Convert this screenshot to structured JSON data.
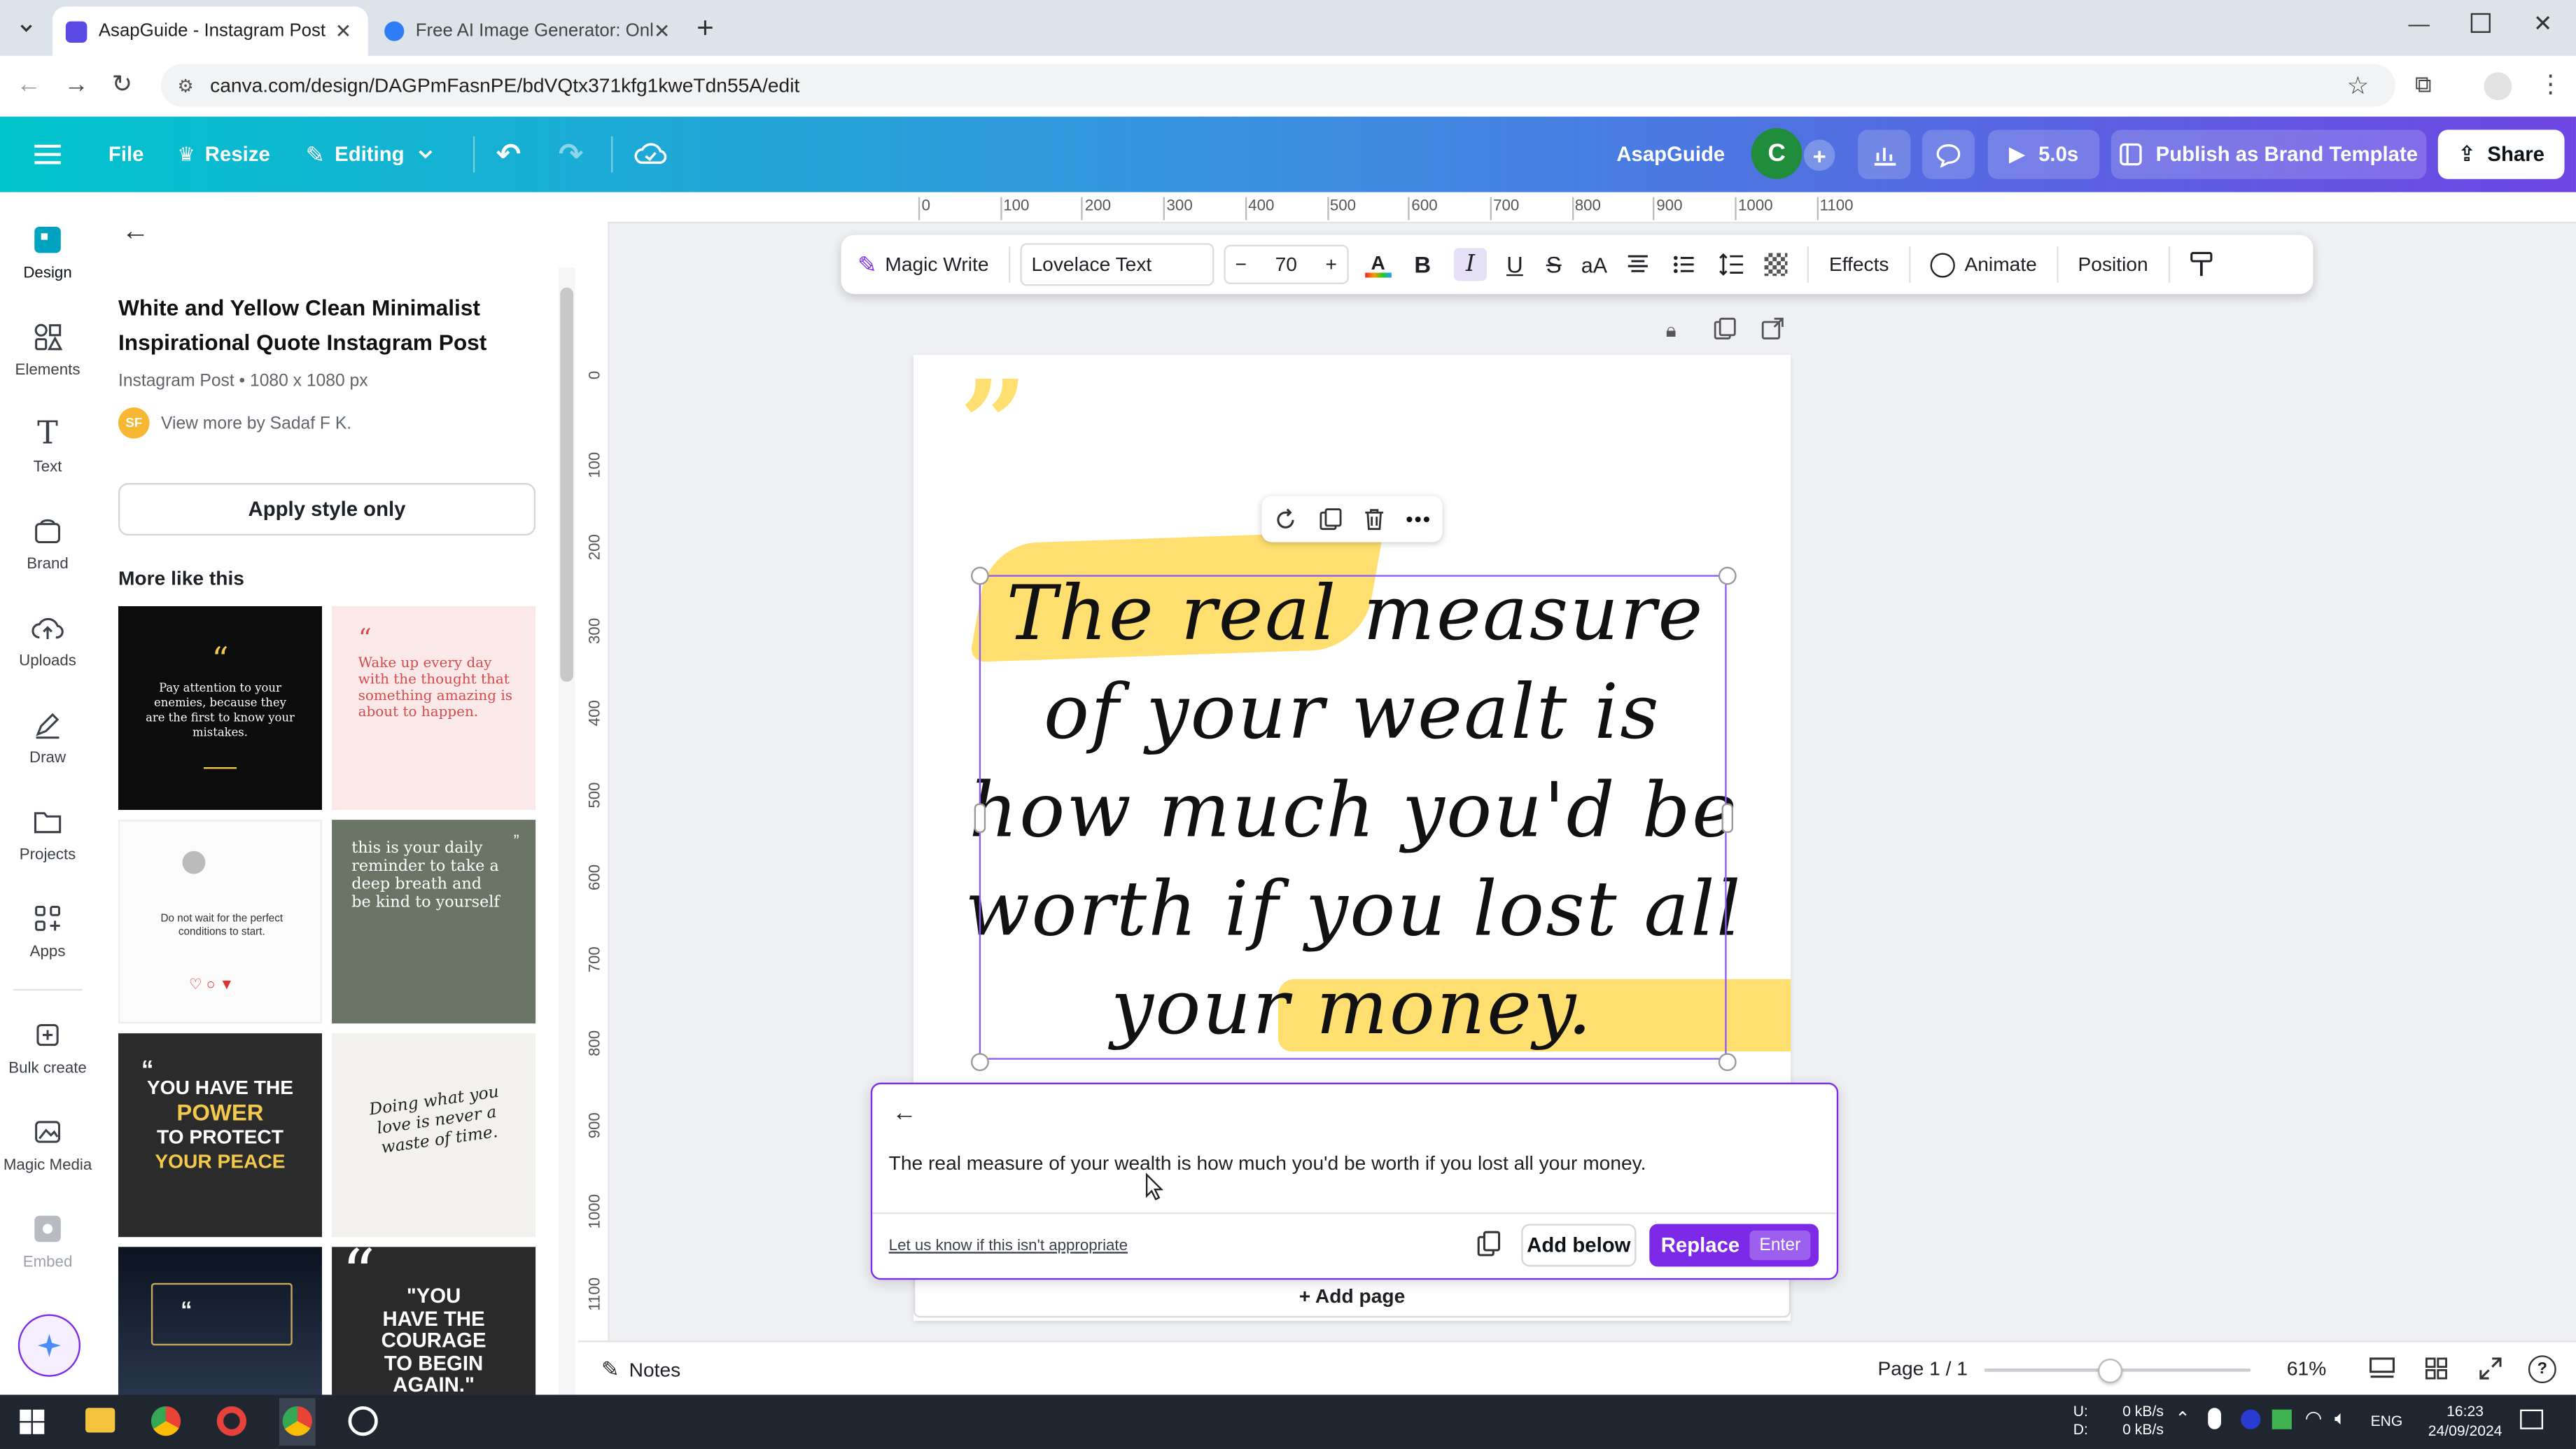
{
  "browser": {
    "tabs": [
      {
        "title": "AsapGuide - Instagram Post",
        "active": true
      },
      {
        "title": "Free AI Image Generator: Onlin",
        "active": false
      }
    ],
    "url": "canva.com/design/DAGPmFasnPE/bdVQtx371kfg1kweTdn55A/edit"
  },
  "topbar": {
    "file_label": "File",
    "resize_label": "Resize",
    "editing_label": "Editing",
    "project_name": "AsapGuide",
    "avatar_initial": "C",
    "play_label": "5.0s",
    "publish_label": "Publish as Brand Template",
    "share_label": "Share"
  },
  "rail": {
    "items": [
      {
        "label": "Design",
        "icon": "design-icon"
      },
      {
        "label": "Elements",
        "icon": "elements-icon"
      },
      {
        "label": "Text",
        "icon": "text-icon"
      },
      {
        "label": "Brand",
        "icon": "brand-icon"
      },
      {
        "label": "Uploads",
        "icon": "uploads-icon"
      },
      {
        "label": "Draw",
        "icon": "draw-icon"
      },
      {
        "label": "Projects",
        "icon": "projects-icon"
      },
      {
        "label": "Apps",
        "icon": "apps-icon"
      },
      {
        "label": "Bulk create",
        "icon": "bulk-create-icon"
      },
      {
        "label": "Magic Media",
        "icon": "magic-media-icon"
      },
      {
        "label": "Embed",
        "icon": "embed-icon"
      }
    ]
  },
  "panel": {
    "title": "White and Yellow Clean Minimalist Inspirational Quote Instagram Post",
    "meta": "Instagram Post • 1080 x 1080 px",
    "author_initials": "SF",
    "author_link": "View more by Sadaf F K.",
    "apply_label": "Apply style only",
    "more_label": "More like this",
    "thumbs": [
      {
        "text": "Pay attention to your enemies, because they are the first to know your mistakes."
      },
      {
        "text": "Wake up every day with the thought that something amazing is about to happen."
      },
      {
        "text": "Do not wait for the perfect conditions to start."
      },
      {
        "text": "this is your daily reminder to take a deep breath and be kind to yourself"
      },
      {
        "lines": [
          "YOU HAVE THE",
          "POWER",
          "TO PROTECT",
          "YOUR PEACE"
        ]
      },
      {
        "text": "Doing what you love is never a waste of time."
      },
      {
        "text": ""
      },
      {
        "lines": [
          "\"YOU",
          "HAVE THE",
          "COURAGE",
          "TO BEGIN",
          "AGAIN.\""
        ]
      }
    ]
  },
  "ruler": {
    "h_ticks": [
      "0",
      "100",
      "200",
      "300",
      "400",
      "500",
      "600",
      "700",
      "800",
      "900",
      "1000",
      "1100"
    ],
    "v_ticks": [
      "0",
      "100",
      "200",
      "300",
      "400",
      "500",
      "600",
      "700",
      "800",
      "900",
      "1000",
      "1100"
    ]
  },
  "context_toolbar": {
    "magic_write": "Magic Write",
    "font_name": "Lovelace Text",
    "font_size": "70",
    "effects": "Effects",
    "animate": "Animate",
    "position": "Position"
  },
  "canvas": {
    "quote_lines": [
      "The real measure",
      "of your wealt is",
      "how much you'd be",
      "worth if you lost all",
      "your money."
    ],
    "add_page_label": "+ Add page",
    "highlight_color": "#fedf6f"
  },
  "ai_panel": {
    "suggestion": "The real measure of your wealth is how much you'd be worth if you lost all your money.",
    "report_link": "Let us know if this isn't appropriate",
    "add_below_label": "Add below",
    "replace_label": "Replace",
    "enter_hint": "Enter"
  },
  "bottombar": {
    "notes_label": "Notes",
    "page_indicator": "Page 1 / 1",
    "zoom_level": "61%",
    "zoom_fraction": 0.46
  },
  "taskbar": {
    "net_up_label": "U:",
    "net_down_label": "D:",
    "net_up": "0 kB/s",
    "net_down": "0 kB/s",
    "lang": "ENG",
    "time": "16:23",
    "date": "24/09/2024"
  },
  "colors": {
    "brand_purple": "#7d2ae8",
    "accent_teal": "#00c4cc"
  }
}
